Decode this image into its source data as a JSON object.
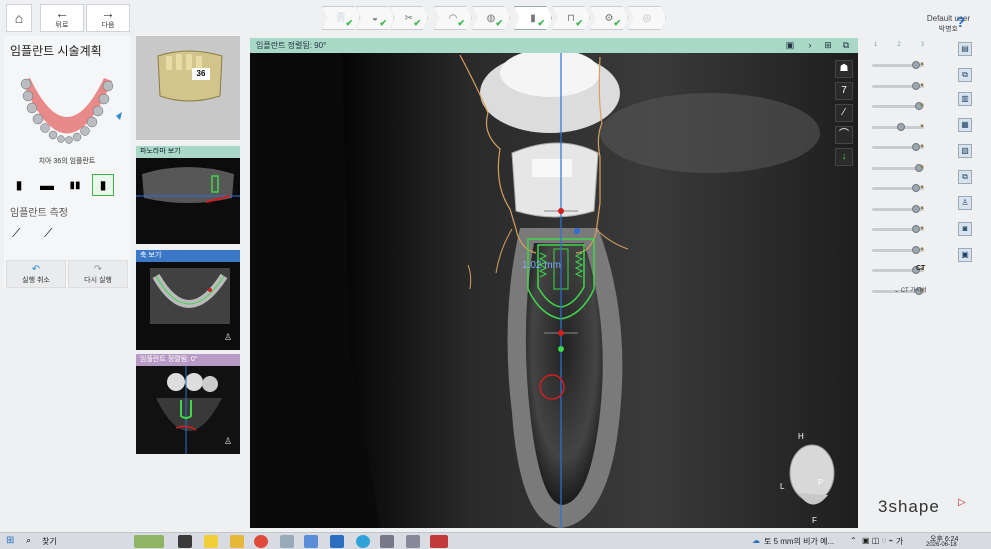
{
  "nav": {
    "home_icon": "home-icon",
    "back_label": "뒤로",
    "next_label": "다음"
  },
  "steps": [
    {
      "name": "step-1",
      "done": true
    },
    {
      "name": "step-2",
      "done": true
    },
    {
      "name": "step-3",
      "done": true
    },
    {
      "name": "step-4",
      "done": true
    },
    {
      "name": "step-5",
      "done": true
    },
    {
      "name": "step-6",
      "done": true,
      "active": true
    },
    {
      "name": "step-7",
      "done": true
    },
    {
      "name": "step-8",
      "done": true
    },
    {
      "name": "step-9",
      "done": false
    }
  ],
  "user": {
    "line1": "Default user",
    "line2": "박병호",
    "help": "?"
  },
  "left_panel": {
    "title": "임플란트 시술계획",
    "info": "i",
    "tooth_caption": "치아 36의 임플란트",
    "section_label": "임플란트 측정",
    "undo_label": "실행 취소",
    "redo_label": "다시 실행"
  },
  "thumbnails": {
    "tooth_number": "36",
    "panorama_title": "파노라마 보기",
    "axial_title": "축 보기",
    "tangential_title": "임플란트 정렬됨: 0°"
  },
  "main_view": {
    "title": "임플란트 정렬됨: 90°",
    "measurement": "1.02 mm",
    "head_labels": {
      "top": "H",
      "left": "L",
      "right": "P",
      "bottom": "F"
    },
    "side_number": "7"
  },
  "right_panel": {
    "tabs": [
      "1",
      "2",
      "3"
    ],
    "ct_label": "CT 가시성",
    "ct_short": "CT",
    "sliders": [
      0.85,
      0.85,
      0.9,
      0.55,
      0.85,
      0.9,
      0.85,
      0.85,
      0.85,
      0.85,
      0.85,
      0.9
    ]
  },
  "brand": "3shape",
  "taskbar": {
    "search_label": "찾기",
    "news": "토 5 mm의 비가 예...",
    "clock_time": "오후 6:24",
    "clock_date": "2026-06-18",
    "ime": "가"
  },
  "colors": {
    "header_green": "#a9d8c6",
    "implant_green": "#3ed64a",
    "axis_blue": "#2e6fd8",
    "nerve_red": "#d21e1e",
    "accent_purple": "#b89ac6",
    "accent_blue": "#3c78c8"
  }
}
